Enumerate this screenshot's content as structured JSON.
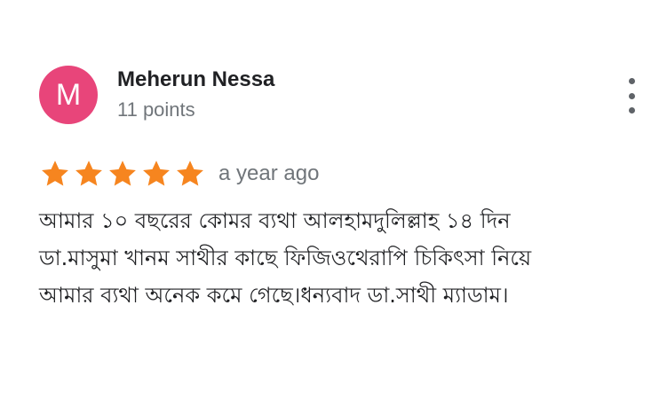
{
  "review": {
    "author": {
      "initial": "M",
      "name": "Meherun Nessa",
      "points": "11 points",
      "avatar_color": "#e8457a"
    },
    "rating": {
      "stars": 5,
      "max": 5,
      "star_color": "#f6851f"
    },
    "time": "a year ago",
    "text_lines": [
      "আমার ১০ বছরের কোমর ব্যথা আলহামদুলিল্লাহ ১৪ দিন",
      "ডা.মাসুমা খানম সাথীর কাছে ফিজিওথেরাপি চিকিৎসা নিয়ে",
      "আমার ব্যথা অনেক কমে গেছে।ধন্যবাদ ডা.সাথী ম্যাডাম।"
    ],
    "more_icon": "more-vert-icon"
  }
}
